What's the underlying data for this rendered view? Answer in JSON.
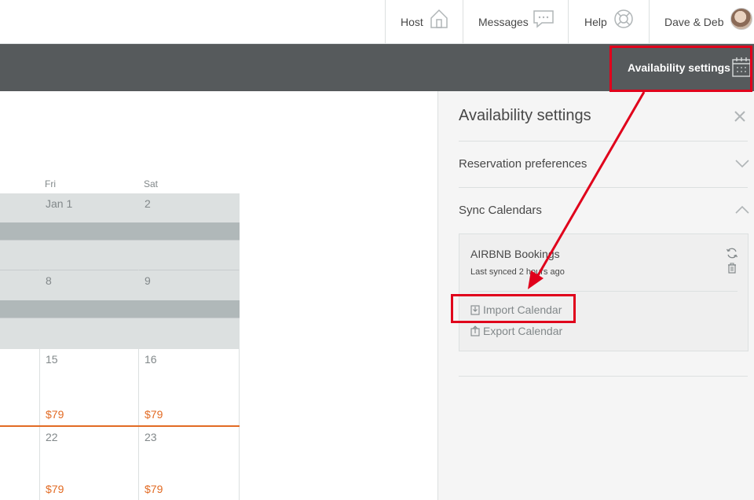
{
  "nav": {
    "host": "Host",
    "messages": "Messages",
    "help": "Help",
    "user": "Dave & Deb"
  },
  "toolbar": {
    "availability_settings": "Availability settings"
  },
  "calendar": {
    "days_of_week": [
      "Fri",
      "Sat"
    ],
    "weeks": [
      {
        "days": [
          "Jan 1",
          "2"
        ],
        "prices": [
          "",
          ""
        ],
        "blocked": true
      },
      {
        "days": [
          "8",
          "9"
        ],
        "prices": [
          "",
          ""
        ],
        "blocked": true
      },
      {
        "days": [
          "15",
          "16"
        ],
        "prices": [
          "$79",
          "$79"
        ],
        "blocked": false
      },
      {
        "days": [
          "22",
          "23"
        ],
        "prices": [
          "$79",
          "$79"
        ],
        "blocked": false
      }
    ]
  },
  "panel": {
    "title": "Availability settings",
    "reservation_preferences": "Reservation preferences",
    "sync_calendars": "Sync Calendars",
    "sync_item": {
      "name": "AIRBNB Bookings",
      "last_synced": "Last synced 2 hours ago"
    },
    "import_calendar": "Import Calendar",
    "export_calendar": "Export Calendar"
  },
  "colors": {
    "accent_highlight": "#e0001b",
    "price": "#e26b24",
    "toolbar": "#565a5c"
  }
}
